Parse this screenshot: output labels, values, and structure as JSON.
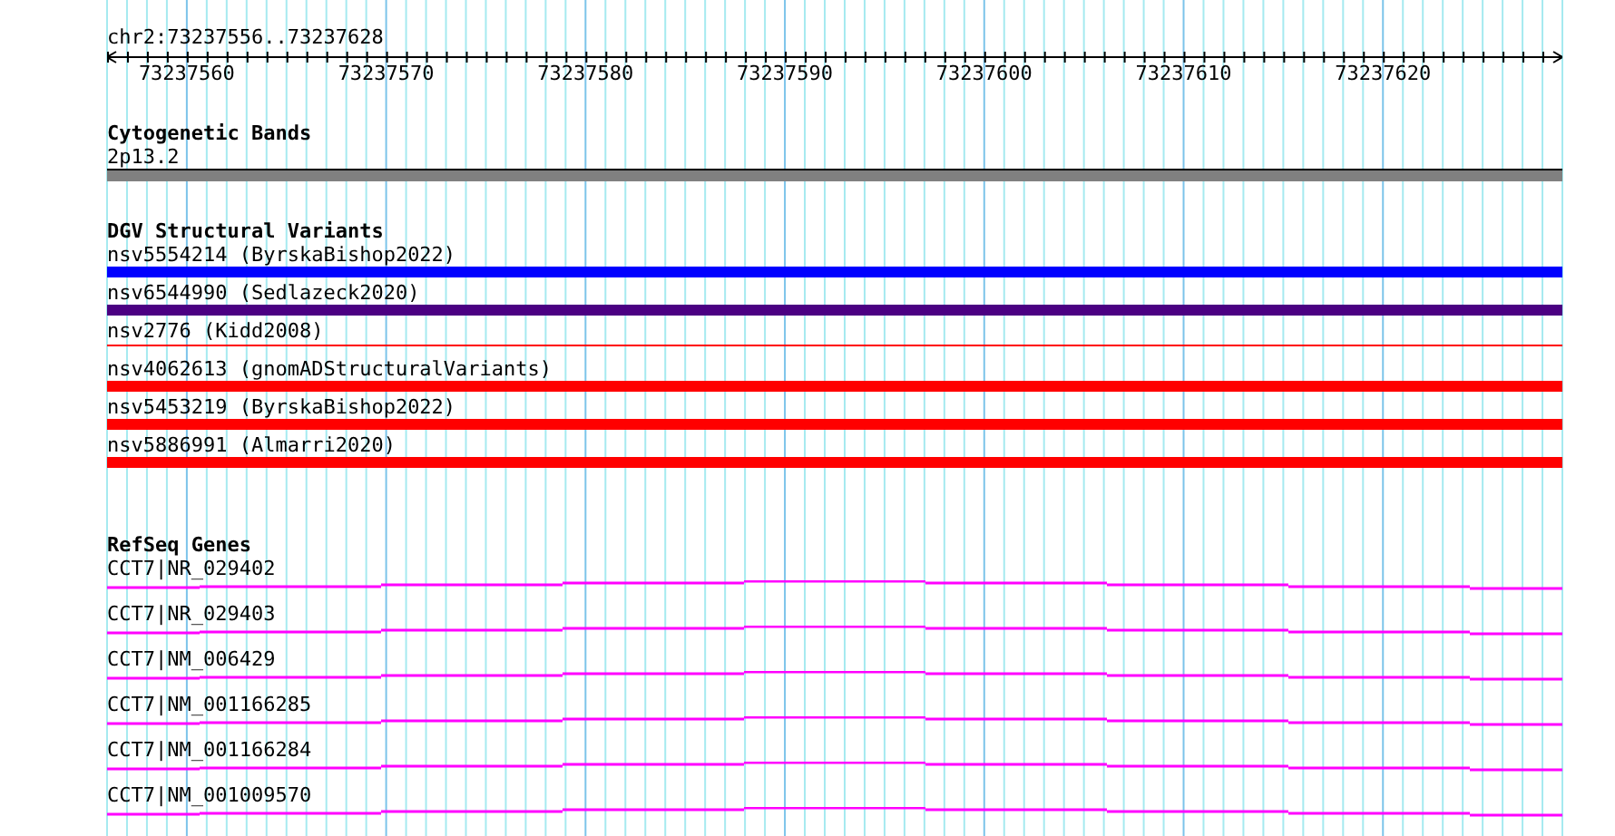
{
  "ruler": {
    "location": "chr2:73237556..73237628",
    "tick_labels": [
      "73237560",
      "73237570",
      "73237580",
      "73237590",
      "73237600",
      "73237610",
      "73237620"
    ]
  },
  "tracks": [
    {
      "kind": "bands",
      "title": "Cytogenetic Bands",
      "features": [
        {
          "label": "2p13.2"
        }
      ]
    },
    {
      "kind": "variants",
      "title": "DGV Structural Variants",
      "features": [
        {
          "label": "nsv5554214 (ByrskaBishop2022)",
          "kind": "bar",
          "color": "#0000ff"
        },
        {
          "label": "nsv6544990 (Sedlazeck2020)",
          "kind": "bar",
          "color": "#4b0082"
        },
        {
          "label": "nsv2776 (Kidd2008)",
          "kind": "line",
          "color": "#ff0000"
        },
        {
          "label": "nsv4062613 (gnomADStructuralVariants)",
          "kind": "bar",
          "color": "#ff0000"
        },
        {
          "label": "nsv5453219 (ByrskaBishop2022)",
          "kind": "bar",
          "color": "#ff0000"
        },
        {
          "label": "nsv5886991 (Almarri2020)",
          "kind": "bar",
          "color": "#ff0000"
        }
      ]
    },
    {
      "kind": "genes",
      "title": "RefSeq Genes",
      "features": [
        {
          "label": "CCT7|NR_029402"
        },
        {
          "label": "CCT7|NR_029403"
        },
        {
          "label": "CCT7|NM_006429"
        },
        {
          "label": "CCT7|NM_001166285"
        },
        {
          "label": "CCT7|NM_001166284"
        },
        {
          "label": "CCT7|NM_001009570"
        }
      ]
    }
  ]
}
